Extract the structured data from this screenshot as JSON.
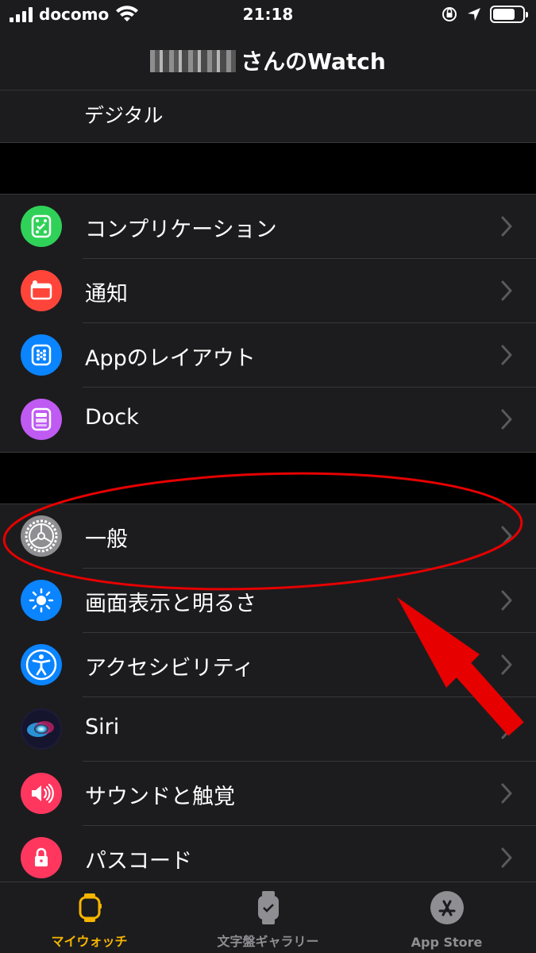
{
  "status": {
    "carrier": "docomo",
    "time": "21:18",
    "battery_level": 0.75
  },
  "nav": {
    "title": "さんのWatch"
  },
  "partial": {
    "text": "デジタル"
  },
  "group1": [
    {
      "label": "コンプリケーション",
      "icon": "complications-icon",
      "color": "#30d158"
    },
    {
      "label": "通知",
      "icon": "notifications-icon",
      "color": "#ff453a"
    },
    {
      "label": "Appのレイアウト",
      "icon": "app-layout-icon",
      "color": "#0a84ff"
    },
    {
      "label": "Dock",
      "icon": "dock-icon",
      "color": "#bf5af2"
    }
  ],
  "group2": [
    {
      "label": "一般",
      "icon": "gear-icon",
      "color": "#8e8e93"
    },
    {
      "label": "画面表示と明るさ",
      "icon": "brightness-icon",
      "color": "#0a84ff"
    },
    {
      "label": "アクセシビリティ",
      "icon": "accessibility-icon",
      "color": "#0a84ff"
    },
    {
      "label": "Siri",
      "icon": "siri-icon",
      "color": "#1c1c3a"
    },
    {
      "label": "サウンドと触覚",
      "icon": "speaker-icon",
      "color": "#ff375f"
    },
    {
      "label": "パスコード",
      "icon": "lock-icon",
      "color": "#ff375f"
    }
  ],
  "tabs": [
    {
      "label": "マイウォッチ",
      "icon": "watch-icon",
      "active": true
    },
    {
      "label": "文字盤ギャラリー",
      "icon": "watch-face-icon",
      "active": false
    },
    {
      "label": "App Store",
      "icon": "app-store-icon",
      "active": false
    }
  ],
  "colors": {
    "accent": "#f7b500",
    "annotation": "#e60000"
  }
}
